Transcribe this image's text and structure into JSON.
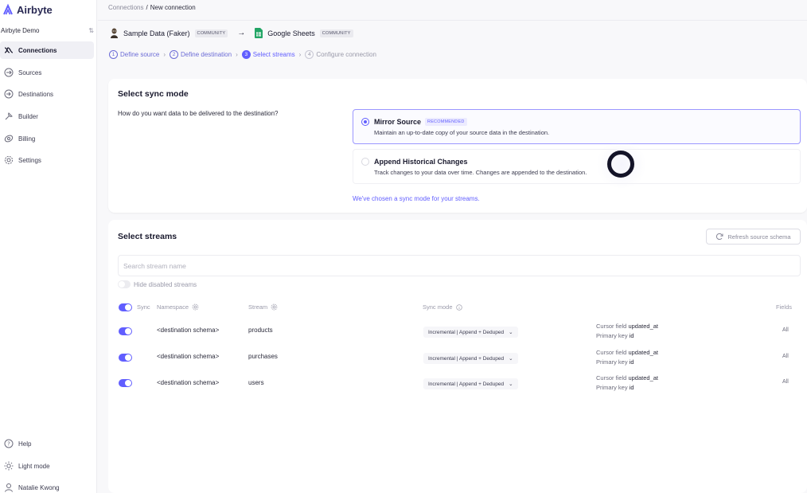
{
  "app": {
    "name": "Airbyte",
    "workspace": "Airbyte Demo"
  },
  "sidebar": {
    "items": [
      {
        "label": "Connections",
        "icon": "connections-icon",
        "active": true
      },
      {
        "label": "Sources",
        "icon": "sources-icon"
      },
      {
        "label": "Destinations",
        "icon": "destinations-icon"
      },
      {
        "label": "Builder",
        "icon": "builder-icon"
      },
      {
        "label": "Billing",
        "icon": "billing-icon"
      },
      {
        "label": "Settings",
        "icon": "settings-icon"
      }
    ],
    "bottom": [
      {
        "label": "Help",
        "icon": "help-icon"
      },
      {
        "label": "Light mode",
        "icon": "sun-icon"
      },
      {
        "label": "Natalie Kwong",
        "icon": "user-icon"
      }
    ]
  },
  "breadcrumb": {
    "parent": "Connections",
    "sep": "/",
    "current": "New connection"
  },
  "connection": {
    "source": "Sample Data (Faker)",
    "source_badge": "COMMUNITY",
    "arrow": "→",
    "destination": "Google Sheets",
    "destination_badge": "COMMUNITY"
  },
  "steps": [
    {
      "num": "1",
      "label": "Define source"
    },
    {
      "num": "2",
      "label": "Define destination"
    },
    {
      "num": "3",
      "label": "Select streams"
    },
    {
      "num": "4",
      "label": "Configure connection"
    }
  ],
  "sync_mode": {
    "title": "Select sync mode",
    "question": "How do you want data to be delivered to the destination?",
    "options": [
      {
        "title": "Mirror Source",
        "badge": "RECOMMENDED",
        "desc": "Maintain an up-to-date copy of your source data in the destination.",
        "selected": true
      },
      {
        "title": "Append Historical Changes",
        "desc": "Track changes to your data over time. Changes are appended to the destination.",
        "selected": false
      }
    ],
    "chosen_note": "We've chosen a sync mode for your streams."
  },
  "streams": {
    "title": "Select streams",
    "refresh_label": "Refresh source schema",
    "search_placeholder": "Search stream name",
    "hide_disabled_label": "Hide disabled streams",
    "headers": {
      "sync": "Sync",
      "namespace": "Namespace",
      "stream": "Stream",
      "sync_mode": "Sync mode",
      "fields": "Fields"
    },
    "rows": [
      {
        "namespace": "<destination schema>",
        "stream": "products",
        "sync_mode": "Incremental | Append + Deduped",
        "cursor_label": "Cursor field",
        "cursor_value": "updated_at",
        "pk_label": "Primary key",
        "pk_value": "id",
        "fields": "All"
      },
      {
        "namespace": "<destination schema>",
        "stream": "purchases",
        "sync_mode": "Incremental | Append + Deduped",
        "cursor_label": "Cursor field",
        "cursor_value": "updated_at",
        "pk_label": "Primary key",
        "pk_value": "id",
        "fields": "All"
      },
      {
        "namespace": "<destination schema>",
        "stream": "users",
        "sync_mode": "Incremental | Append + Deduped",
        "cursor_label": "Cursor field",
        "cursor_value": "updated_at",
        "pk_label": "Primary key",
        "pk_value": "id",
        "fields": "All"
      }
    ]
  },
  "colors": {
    "accent": "#615eff",
    "text": "#1a1a2e",
    "muted": "#9a9aaa"
  }
}
